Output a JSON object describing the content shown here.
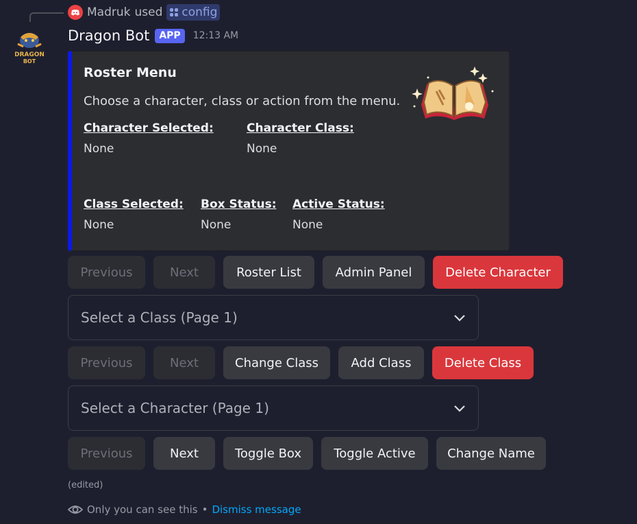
{
  "reply": {
    "user": "Madruk",
    "used_text": "used",
    "command": "config",
    "icon": "discord-logo-icon"
  },
  "message": {
    "bot_name": "Dragon Bot",
    "app_tag": "APP",
    "timestamp": "12:13 AM",
    "avatar_text": [
      "DRAGON",
      "BOT"
    ]
  },
  "embed": {
    "accent_color": "#0b19e6",
    "title": "Roster Menu",
    "description": "Choose a character, class or action from the menu.",
    "fields": [
      {
        "name": "Character Selected:",
        "value": "None"
      },
      {
        "name": "Character Class:",
        "value": "None"
      },
      {
        "name": "Class Selected:",
        "value": "None"
      },
      {
        "name": "Box Status:",
        "value": "None"
      },
      {
        "name": "Active Status:",
        "value": "None"
      }
    ],
    "thumbnail_icon": "spellbook-icon"
  },
  "row1": {
    "previous": "Previous",
    "next": "Next",
    "roster_list": "Roster List",
    "admin_panel": "Admin Panel",
    "delete_character": "Delete Character"
  },
  "class_select": {
    "placeholder": "Select a Class (Page 1)"
  },
  "row2": {
    "previous": "Previous",
    "next": "Next",
    "change_class": "Change Class",
    "add_class": "Add Class",
    "delete_class": "Delete Class"
  },
  "character_select": {
    "placeholder": "Select a Character (Page 1)"
  },
  "row3": {
    "previous": "Previous",
    "next": "Next",
    "toggle_box": "Toggle Box",
    "toggle_active": "Toggle Active",
    "change_name": "Change Name"
  },
  "edited": "(edited)",
  "footer": {
    "only_you": "Only you can see this",
    "separator": "•",
    "dismiss": "Dismiss message"
  },
  "colors": {
    "background": "#1e1f2e",
    "danger": "#da373c",
    "brand": "#5865f2",
    "link": "#00a8fc"
  }
}
